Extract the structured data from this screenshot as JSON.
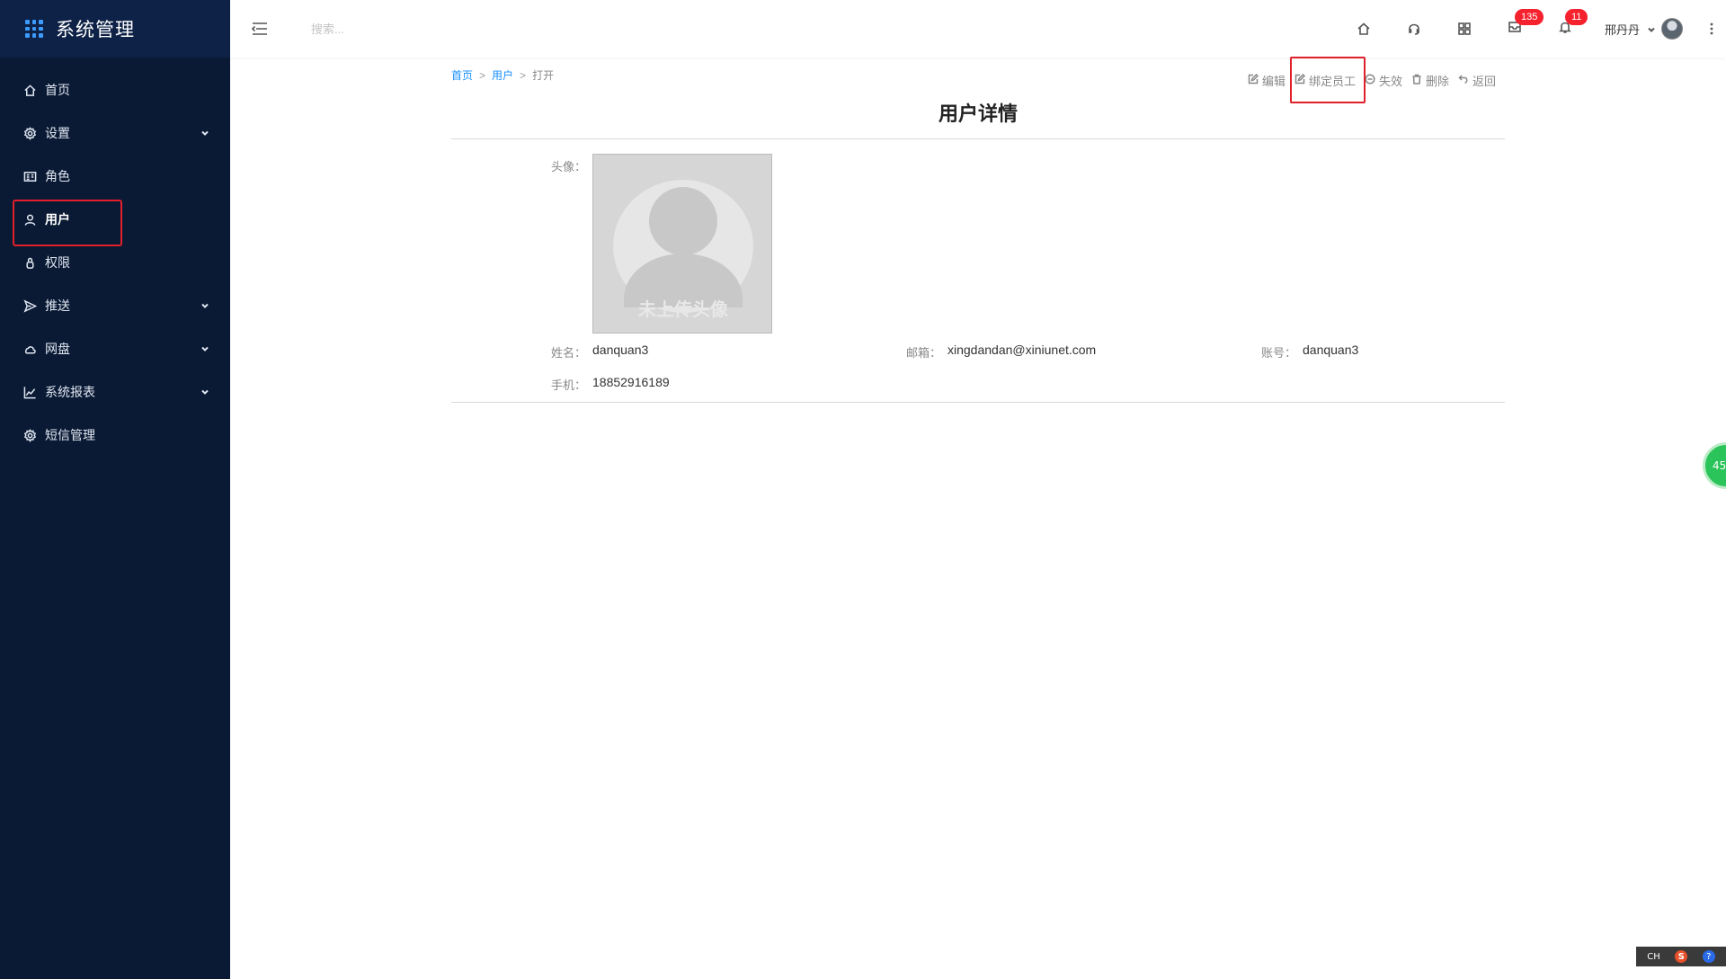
{
  "app": {
    "title": "系统管理"
  },
  "sidebar": {
    "items": [
      {
        "label": "首页",
        "icon": "home-icon",
        "expandable": false
      },
      {
        "label": "设置",
        "icon": "gear-icon",
        "expandable": true
      },
      {
        "label": "角色",
        "icon": "id-card-icon",
        "expandable": false
      },
      {
        "label": "用户",
        "icon": "user-icon",
        "expandable": false,
        "active": true
      },
      {
        "label": "权限",
        "icon": "lock-icon",
        "expandable": false
      },
      {
        "label": "推送",
        "icon": "send-icon",
        "expandable": true
      },
      {
        "label": "网盘",
        "icon": "cloud-icon",
        "expandable": true
      },
      {
        "label": "系统报表",
        "icon": "line-chart-icon",
        "expandable": true
      },
      {
        "label": "短信管理",
        "icon": "gear-icon",
        "expandable": false
      }
    ]
  },
  "header": {
    "search_placeholder": "搜索...",
    "message_count": "135",
    "notification_count": "11",
    "user_name": "邢丹丹"
  },
  "breadcrumb": {
    "home": "首页",
    "users": "用户",
    "sep": ">",
    "current": "打开"
  },
  "actions": {
    "edit": "编辑",
    "bind_employee": "绑定员工",
    "disable": "失效",
    "delete": "删除",
    "back": "返回"
  },
  "page": {
    "title": "用户详情"
  },
  "detail": {
    "avatar_label": "头像：",
    "avatar_placeholder": "未上传头像",
    "name_label": "姓名：",
    "name": "danquan3",
    "email_label": "邮箱：",
    "email": "xingdandan@xiniunet.com",
    "account_label": "账号：",
    "account": "danquan3",
    "phone_label": "手机：",
    "phone": "18852916189"
  },
  "widgets": {
    "green_float": "45",
    "ime_lang": "CH",
    "ime_s": "S",
    "ime_help": "?"
  },
  "colors": {
    "sidebar_bg": "#0b1a34",
    "link": "#1890ff",
    "badge": "#f5222d",
    "highlight_box": "#e0202a"
  }
}
